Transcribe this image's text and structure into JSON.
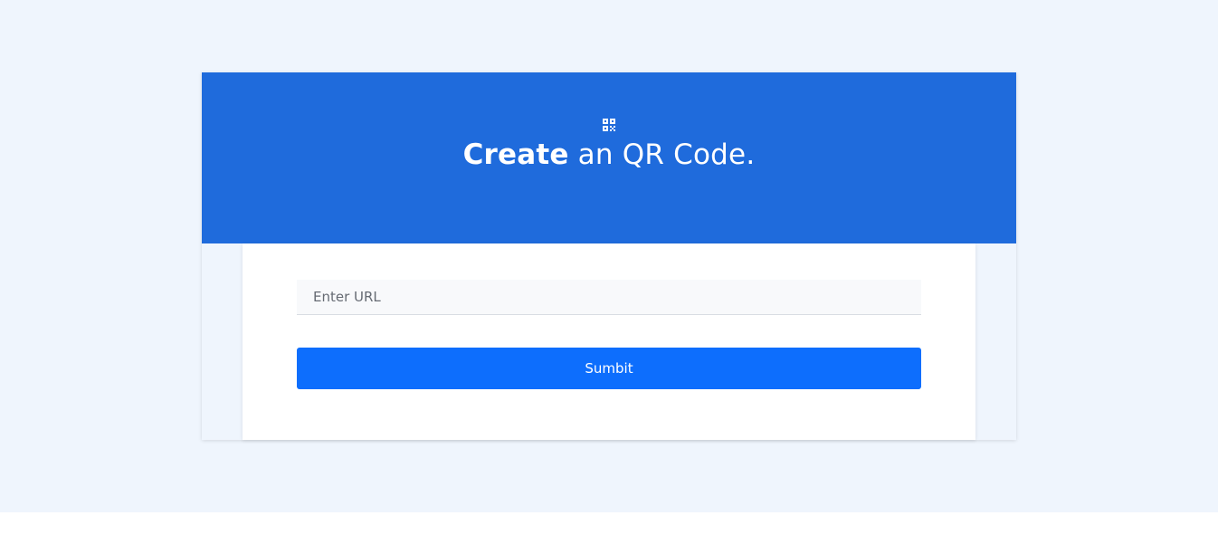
{
  "colors": {
    "page_background": "#eff5fd",
    "hero_background": "#1f6bdc",
    "button_background": "#0d6efd",
    "hero_text": "#ffffff"
  },
  "hero": {
    "icon": "qr-code-icon",
    "title_strong": "Create",
    "title_rest": " an QR Code."
  },
  "form": {
    "url_placeholder": "Enter URL",
    "url_value": "",
    "submit_label": "Sumbit"
  }
}
